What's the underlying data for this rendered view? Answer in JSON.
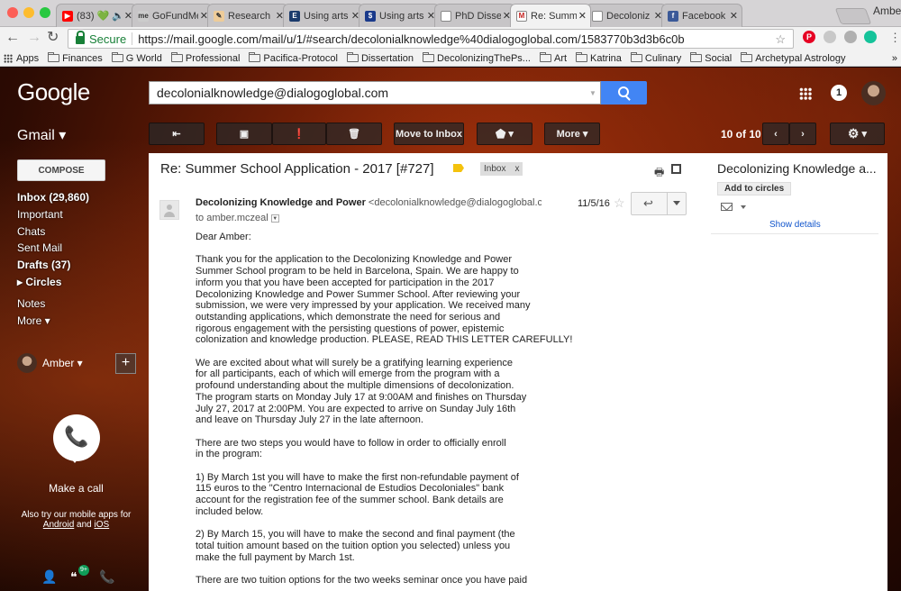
{
  "browser": {
    "tabs": [
      {
        "label": "(83) 💚 🔈",
        "favicon": "youtube-icon",
        "color": "#ff0000",
        "glyph": "▶"
      },
      {
        "label": "GoFundMe",
        "favicon": "gofundme-icon",
        "color": "#cccccc",
        "glyph": "me"
      },
      {
        "label": "Research",
        "favicon": "research-icon",
        "color": "#eecc99",
        "glyph": "✎"
      },
      {
        "label": "Using arts",
        "favicon": "journal-icon",
        "color": "#1a3a6b",
        "glyph": "E"
      },
      {
        "label": "Using arts",
        "favicon": "s-circle-icon",
        "color": "#1a3a8b",
        "glyph": "$"
      },
      {
        "label": "PhD Disse",
        "favicon": "doc-icon",
        "color": "#ffffff",
        "glyph": ""
      },
      {
        "label": "Re: Summ",
        "favicon": "gmail-icon",
        "color": "#ffffff",
        "glyph": "M",
        "active": true
      },
      {
        "label": "Decoloniz",
        "favicon": "doc-icon",
        "color": "#ffffff",
        "glyph": ""
      },
      {
        "label": "Facebook",
        "favicon": "facebook-icon",
        "color": "#3b5998",
        "glyph": "f"
      }
    ],
    "profile_name": "Amber",
    "secure_label": "Secure",
    "url": "https://mail.google.com/mail/u/1/#search/decolonialknowledge%40dialogoglobal.com/1583770b3d3b6c0b",
    "bookmarks_apps": "Apps",
    "bookmarks": [
      "Finances",
      "G World",
      "Professional",
      "Pacifica-Protocol",
      "Dissertation",
      "DecolonizingThePs...",
      "Art",
      "Katrina",
      "Culinary",
      "Social",
      "Archetypal Astrology"
    ],
    "overflow": "»"
  },
  "gmail": {
    "logo": "Google",
    "search_value": "decolonialknowledge@dialogoglobal.com",
    "notification_count": "1",
    "app_label": "Gmail ▾",
    "toolbar": {
      "move_to_inbox": "Move to Inbox",
      "more": "More ▾",
      "labels_caret": "▾",
      "page_count": "10 of 10"
    },
    "compose": "COMPOSE",
    "nav": [
      {
        "label": "Inbox (29,860)",
        "bold": true
      },
      {
        "label": "Important",
        "bold": false
      },
      {
        "label": "Chats",
        "bold": false
      },
      {
        "label": "Sent Mail",
        "bold": false
      },
      {
        "label": "Drafts (37)",
        "bold": true
      },
      {
        "label": "▸ Circles",
        "bold": true
      },
      {
        "label": "",
        "bold": false
      },
      {
        "label": "Notes",
        "bold": false
      },
      {
        "label": "More ▾",
        "bold": false
      }
    ],
    "hangouts_user": "Amber ▾",
    "make_call": "Make a call",
    "mobile_apps_text": "Also try our mobile apps for",
    "android": "Android",
    "and": "and",
    "ios": "iOS",
    "hangouts_badge": "9+"
  },
  "message": {
    "subject": "Re: Summer School Application - 2017 [#727]",
    "label_tag": "Inbox",
    "label_remove": "x",
    "sender_name": "Decolonizing Knowledge and Power",
    "sender_email": "<decolonialknowledge@dialogoglobal.com>",
    "to": "to amber.mczeal",
    "date": "11/5/16",
    "paragraphs": [
      "Dear Amber:",
      "Thank you for the application to the Decolonizing Knowledge and Power\nSummer School program to be held in Barcelona, Spain. We are happy to\ninform you that you have been accepted for participation in the 2017\nDecolonizing Knowledge and Power Summer School. After reviewing your\nsubmission, we were very impressed by your application. We received many\noutstanding applications, which demonstrate the need for serious and\nrigorous engagement with the persisting questions of power, epistemic\ncolonization and knowledge production. PLEASE, READ THIS LETTER CAREFULLY!",
      "We are excited about what will surely be a gratifying learning experience\nfor all participants, each of which will emerge from the program with a\nprofound understanding about the multiple dimensions of decolonization.\nThe program starts on Monday July 17 at 9:00AM and finishes on Thursday\nJuly 27, 2017 at 2:00PM. You are expected to arrive on Sunday July 16th\nand leave on Thursday July 27 in the late afternoon.",
      "There are two steps you would have to follow in order to officially enroll\nin the program:",
      "1) By March 1st you will have to make the first non-refundable payment of\n115 euros to the \"Centro Internacional de Estudios Decoloniales\" bank\naccount for the registration fee of the summer school. Bank details are\nincluded below.",
      "2) By March 15, you will have to make the second and final payment (the\ntotal tuition amount based on the tuition option you selected) unless you\nmake the full payment by March 1st.",
      "There are two tuition options for the two weeks seminar once you have paid"
    ]
  },
  "contact_card": {
    "name": "Decolonizing Knowledge a...",
    "add_to_circles": "Add to circles",
    "show_details": "Show details"
  }
}
